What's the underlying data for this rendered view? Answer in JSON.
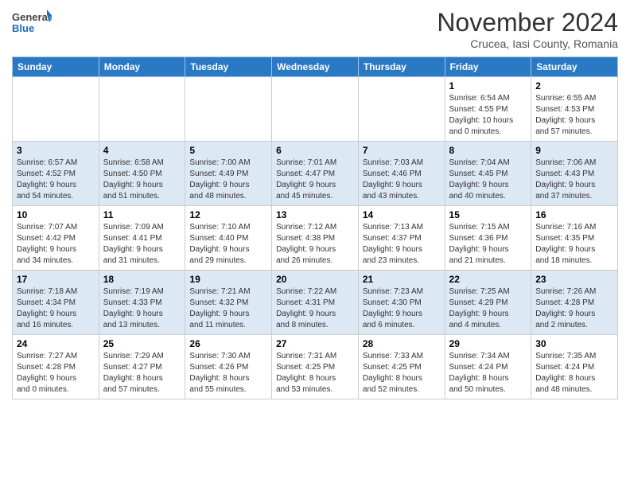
{
  "header": {
    "logo_general": "General",
    "logo_blue": "Blue",
    "month_title": "November 2024",
    "subtitle": "Crucea, Iasi County, Romania"
  },
  "weekdays": [
    "Sunday",
    "Monday",
    "Tuesday",
    "Wednesday",
    "Thursday",
    "Friday",
    "Saturday"
  ],
  "weeks": [
    [
      {
        "day": "",
        "info": ""
      },
      {
        "day": "",
        "info": ""
      },
      {
        "day": "",
        "info": ""
      },
      {
        "day": "",
        "info": ""
      },
      {
        "day": "",
        "info": ""
      },
      {
        "day": "1",
        "info": "Sunrise: 6:54 AM\nSunset: 4:55 PM\nDaylight: 10 hours\nand 0 minutes."
      },
      {
        "day": "2",
        "info": "Sunrise: 6:55 AM\nSunset: 4:53 PM\nDaylight: 9 hours\nand 57 minutes."
      }
    ],
    [
      {
        "day": "3",
        "info": "Sunrise: 6:57 AM\nSunset: 4:52 PM\nDaylight: 9 hours\nand 54 minutes."
      },
      {
        "day": "4",
        "info": "Sunrise: 6:58 AM\nSunset: 4:50 PM\nDaylight: 9 hours\nand 51 minutes."
      },
      {
        "day": "5",
        "info": "Sunrise: 7:00 AM\nSunset: 4:49 PM\nDaylight: 9 hours\nand 48 minutes."
      },
      {
        "day": "6",
        "info": "Sunrise: 7:01 AM\nSunset: 4:47 PM\nDaylight: 9 hours\nand 45 minutes."
      },
      {
        "day": "7",
        "info": "Sunrise: 7:03 AM\nSunset: 4:46 PM\nDaylight: 9 hours\nand 43 minutes."
      },
      {
        "day": "8",
        "info": "Sunrise: 7:04 AM\nSunset: 4:45 PM\nDaylight: 9 hours\nand 40 minutes."
      },
      {
        "day": "9",
        "info": "Sunrise: 7:06 AM\nSunset: 4:43 PM\nDaylight: 9 hours\nand 37 minutes."
      }
    ],
    [
      {
        "day": "10",
        "info": "Sunrise: 7:07 AM\nSunset: 4:42 PM\nDaylight: 9 hours\nand 34 minutes."
      },
      {
        "day": "11",
        "info": "Sunrise: 7:09 AM\nSunset: 4:41 PM\nDaylight: 9 hours\nand 31 minutes."
      },
      {
        "day": "12",
        "info": "Sunrise: 7:10 AM\nSunset: 4:40 PM\nDaylight: 9 hours\nand 29 minutes."
      },
      {
        "day": "13",
        "info": "Sunrise: 7:12 AM\nSunset: 4:38 PM\nDaylight: 9 hours\nand 26 minutes."
      },
      {
        "day": "14",
        "info": "Sunrise: 7:13 AM\nSunset: 4:37 PM\nDaylight: 9 hours\nand 23 minutes."
      },
      {
        "day": "15",
        "info": "Sunrise: 7:15 AM\nSunset: 4:36 PM\nDaylight: 9 hours\nand 21 minutes."
      },
      {
        "day": "16",
        "info": "Sunrise: 7:16 AM\nSunset: 4:35 PM\nDaylight: 9 hours\nand 18 minutes."
      }
    ],
    [
      {
        "day": "17",
        "info": "Sunrise: 7:18 AM\nSunset: 4:34 PM\nDaylight: 9 hours\nand 16 minutes."
      },
      {
        "day": "18",
        "info": "Sunrise: 7:19 AM\nSunset: 4:33 PM\nDaylight: 9 hours\nand 13 minutes."
      },
      {
        "day": "19",
        "info": "Sunrise: 7:21 AM\nSunset: 4:32 PM\nDaylight: 9 hours\nand 11 minutes."
      },
      {
        "day": "20",
        "info": "Sunrise: 7:22 AM\nSunset: 4:31 PM\nDaylight: 9 hours\nand 8 minutes."
      },
      {
        "day": "21",
        "info": "Sunrise: 7:23 AM\nSunset: 4:30 PM\nDaylight: 9 hours\nand 6 minutes."
      },
      {
        "day": "22",
        "info": "Sunrise: 7:25 AM\nSunset: 4:29 PM\nDaylight: 9 hours\nand 4 minutes."
      },
      {
        "day": "23",
        "info": "Sunrise: 7:26 AM\nSunset: 4:28 PM\nDaylight: 9 hours\nand 2 minutes."
      }
    ],
    [
      {
        "day": "24",
        "info": "Sunrise: 7:27 AM\nSunset: 4:28 PM\nDaylight: 9 hours\nand 0 minutes."
      },
      {
        "day": "25",
        "info": "Sunrise: 7:29 AM\nSunset: 4:27 PM\nDaylight: 8 hours\nand 57 minutes."
      },
      {
        "day": "26",
        "info": "Sunrise: 7:30 AM\nSunset: 4:26 PM\nDaylight: 8 hours\nand 55 minutes."
      },
      {
        "day": "27",
        "info": "Sunrise: 7:31 AM\nSunset: 4:25 PM\nDaylight: 8 hours\nand 53 minutes."
      },
      {
        "day": "28",
        "info": "Sunrise: 7:33 AM\nSunset: 4:25 PM\nDaylight: 8 hours\nand 52 minutes."
      },
      {
        "day": "29",
        "info": "Sunrise: 7:34 AM\nSunset: 4:24 PM\nDaylight: 8 hours\nand 50 minutes."
      },
      {
        "day": "30",
        "info": "Sunrise: 7:35 AM\nSunset: 4:24 PM\nDaylight: 8 hours\nand 48 minutes."
      }
    ]
  ],
  "row_styles": [
    "row-light",
    "row-dark",
    "row-light",
    "row-dark",
    "row-light"
  ]
}
